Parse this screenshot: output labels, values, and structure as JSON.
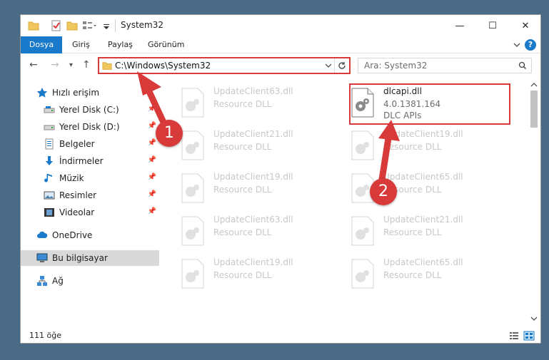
{
  "window": {
    "title": "System32",
    "controls": {
      "minimize": "—",
      "maximize": "☐",
      "close": "✕"
    }
  },
  "ribbon": {
    "tabs": [
      "Dosya",
      "Giriş",
      "Paylaş",
      "Görünüm"
    ],
    "help": "?"
  },
  "address": {
    "path": "C:\\Windows\\System32",
    "search_placeholder": "Ara: System32"
  },
  "sidebar": {
    "items": [
      {
        "label": "Hızlı erişim",
        "icon": "star-icon",
        "pinned": false
      },
      {
        "label": "Yerel Disk (C:)",
        "icon": "drive-icon",
        "pinned": true
      },
      {
        "label": "Yerel Disk (D:)",
        "icon": "drive-icon",
        "pinned": true
      },
      {
        "label": "Belgeler",
        "icon": "documents-icon",
        "pinned": true
      },
      {
        "label": "İndirmeler",
        "icon": "download-icon",
        "pinned": true
      },
      {
        "label": "Müzik",
        "icon": "music-icon",
        "pinned": true
      },
      {
        "label": "Resimler",
        "icon": "pictures-icon",
        "pinned": true
      },
      {
        "label": "Videolar",
        "icon": "videos-icon",
        "pinned": true
      },
      {
        "label": "OneDrive",
        "icon": "cloud-icon",
        "pinned": false
      },
      {
        "label": "Bu bilgisayar",
        "icon": "computer-icon",
        "pinned": false,
        "selected": true
      },
      {
        "label": "Ağ",
        "icon": "network-icon",
        "pinned": false
      }
    ]
  },
  "files": {
    "left": [
      {
        "name": "UpdateClient63.dll",
        "type": "Resource DLL"
      },
      {
        "name": "UpdateClient21.dll",
        "type": "Resource DLL"
      },
      {
        "name": "UpdateClient19.dll",
        "type": "Resource DLL"
      },
      {
        "name": "UpdateClient63.dll",
        "type": "Resource DLL"
      },
      {
        "name": "UpdateClient19.dll",
        "type": "Resource DLL"
      }
    ],
    "right_highlight": {
      "name": "dlcapi.dll",
      "version": "4.0.1381.164",
      "description": "DLC APIs"
    },
    "right": [
      {
        "name": "UpdateClient19.dll",
        "type": "Resource DLL"
      },
      {
        "name": "UpdateClient65.dll",
        "type": "Resource DLL"
      },
      {
        "name": "UpdateClient21.dll",
        "type": "Resource DLL"
      },
      {
        "name": "UpdateClient65.dll",
        "type": "Resource DLL"
      }
    ]
  },
  "status": {
    "count": "111 öğe"
  },
  "annotations": {
    "step1": "1",
    "step2": "2"
  },
  "colors": {
    "accent": "#1979ca",
    "highlight": "#d83a3a",
    "desktop": "#4a6a86"
  }
}
